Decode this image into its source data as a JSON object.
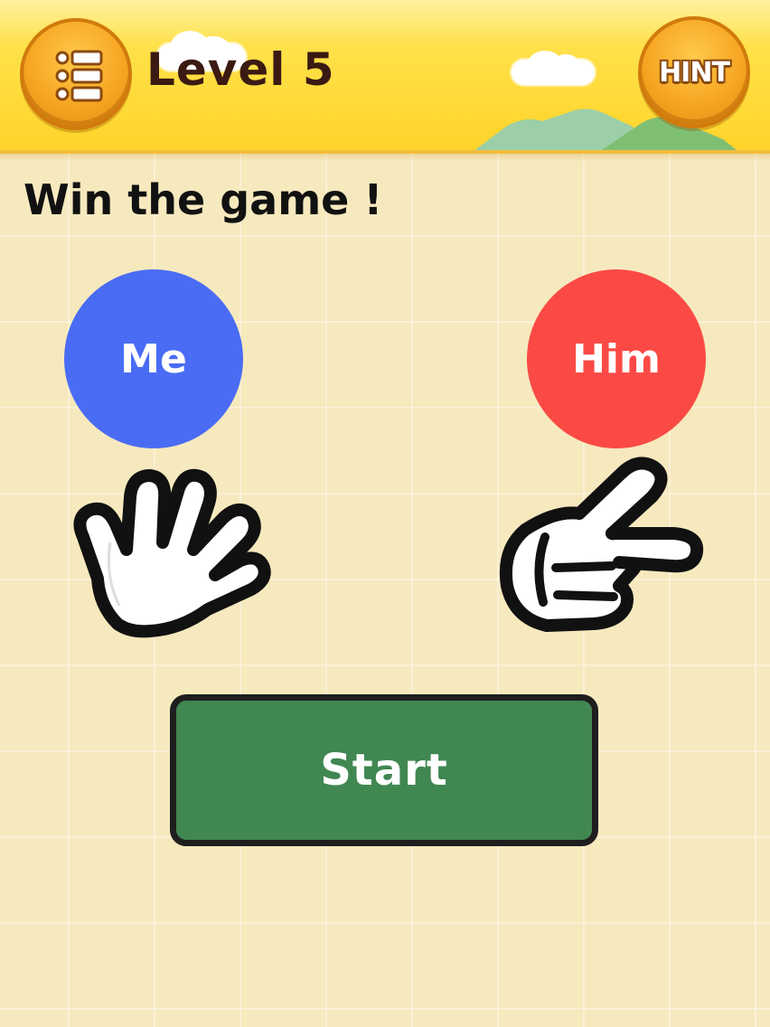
{
  "header": {
    "level_title": "Level 5",
    "hint_label": "HINT"
  },
  "instruction": "Win the game !",
  "players": {
    "me": {
      "label": "Me",
      "hand": "paper-hand-icon",
      "color": "#4a6cf4"
    },
    "him": {
      "label": "Him",
      "hand": "scissors-hand-icon",
      "color": "#fb4a45"
    }
  },
  "start_button": {
    "label": "Start",
    "color": "#418752"
  },
  "colors": {
    "header": "#ffd42a",
    "button_orange": "#f6a623",
    "background": "#f6e9be"
  }
}
